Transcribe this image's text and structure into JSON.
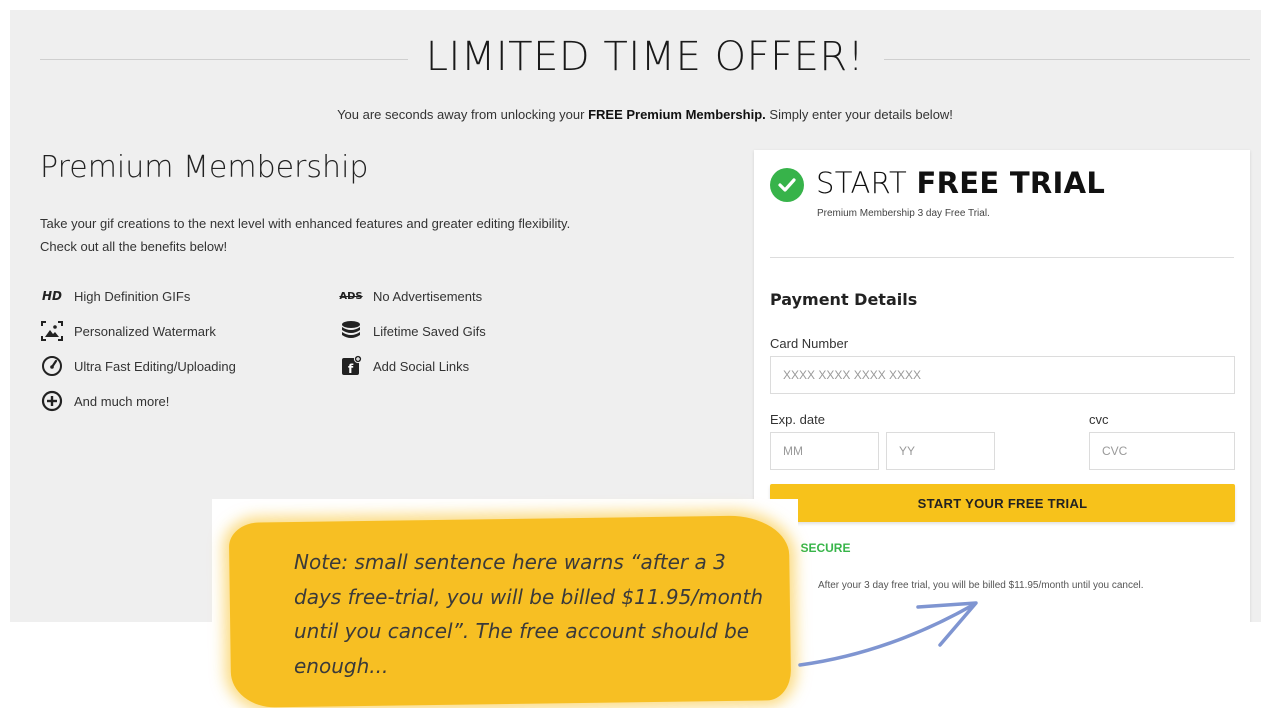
{
  "headline": "LIMITED TIME OFFER!",
  "subline": {
    "pre": "You are seconds away from unlocking your ",
    "bold": "FREE Premium Membership.",
    "post": " Simply enter your details below!"
  },
  "membership": {
    "title": "Premium Membership",
    "desc_line1": "Take your gif creations to the next level with enhanced features and greater editing flexibility.",
    "desc_line2": "Check out all the benefits below!",
    "benefits": [
      {
        "label": "High Definition GIFs",
        "icon": "hd-icon",
        "glyph": "HD"
      },
      {
        "label": "Personalized Watermark",
        "icon": "watermark-icon"
      },
      {
        "label": "Ultra Fast Editing/Uploading",
        "icon": "speedometer-icon"
      },
      {
        "label": "And much more!",
        "icon": "plus-circle-icon"
      },
      {
        "label": "No Advertisements",
        "icon": "no-ads-icon",
        "glyph": "ADS"
      },
      {
        "label": "Lifetime Saved Gifs",
        "icon": "database-icon"
      },
      {
        "label": "Add Social Links",
        "icon": "facebook-add-icon"
      }
    ]
  },
  "trial": {
    "title_thin": "START ",
    "title_bold": "FREE TRIAL",
    "subtitle": "Premium Membership 3 day Free Trial."
  },
  "payment": {
    "title": "Payment Details",
    "card_label": "Card Number",
    "card_placeholder": "XXXX XXXX XXXX XXXX",
    "exp_label": "Exp. date",
    "mm_placeholder": "MM",
    "yy_placeholder": "YY",
    "cvc_label": "cvc",
    "cvc_placeholder": "CVC",
    "cta": "START YOUR FREE TRIAL",
    "ssl": "SL SECURE",
    "fineprint": "After your 3 day free trial, you will be billed $11.95/month until you cancel."
  },
  "note": {
    "text": "Note: small sentence here warns “after a 3 days free-trial, you will be billed $11.95/month until you cancel”. The free account should be enough..."
  },
  "colors": {
    "accent_yellow": "#f7c21b",
    "check_green": "#37b34a",
    "arrow_blue": "#7f95d1",
    "page_bg": "#efefef"
  }
}
